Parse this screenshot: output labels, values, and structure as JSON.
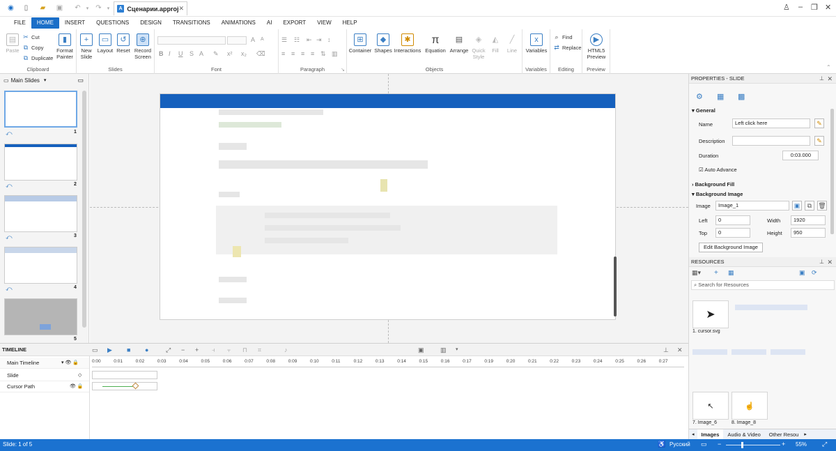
{
  "window": {
    "doc_title": "Сценарии.approj"
  },
  "menu": {
    "items": [
      "FILE",
      "HOME",
      "INSERT",
      "QUESTIONS",
      "DESIGN",
      "TRANSITIONS",
      "ANIMATIONS",
      "AI",
      "EXPORT",
      "VIEW",
      "HELP"
    ],
    "active": "HOME"
  },
  "ribbon": {
    "clipboard": {
      "label": "Clipboard",
      "paste": "Paste",
      "cut": "Cut",
      "copy": "Copy",
      "duplicate": "Duplicate",
      "format_painter": "Format Painter"
    },
    "slides": {
      "label": "Slides",
      "new_slide": "New Slide",
      "layout": "Layout",
      "reset": "Reset",
      "record_screen": "Record Screen"
    },
    "font": {
      "label": "Font"
    },
    "paragraph": {
      "label": "Paragraph"
    },
    "objects": {
      "label": "Objects",
      "container": "Container",
      "shapes": "Shapes",
      "interactions": "Interactions",
      "equation": "Equation",
      "arrange": "Arrange",
      "quick_style": "Quick Style",
      "fill": "Fill",
      "line": "Line"
    },
    "variables": {
      "label": "Variables",
      "button": "Variables"
    },
    "editing": {
      "label": "Editing",
      "find": "Find",
      "replace": "Replace"
    },
    "preview": {
      "label": "Preview",
      "button": "HTML5 Preview"
    }
  },
  "slides_panel": {
    "header": "Main Slides",
    "numbers": [
      "1",
      "2",
      "3",
      "4",
      "5"
    ]
  },
  "properties": {
    "title": "PROPERTIES - SLIDE",
    "general": "General",
    "name_label": "Name",
    "name_value": "Left click here",
    "description_label": "Description",
    "description_value": "",
    "duration_label": "Duration",
    "duration_value": "0:03.000",
    "auto_advance": "Auto Advance",
    "background_fill": "Background Fill",
    "background_image": "Background Image",
    "image_label": "Image",
    "image_value": "Image_1",
    "left_label": "Left",
    "left_value": "0",
    "width_label": "Width",
    "width_value": "1920",
    "top_label": "Top",
    "top_value": "0",
    "height_label": "Height",
    "height_value": "950",
    "edit_bg_button": "Edit Background Image"
  },
  "resources": {
    "title": "RESOURCES",
    "search_placeholder": "Search for Resources",
    "items": [
      "1. cursor.svg",
      "7. Image_6",
      "8. Image_8"
    ],
    "tabs": [
      "Images",
      "Audio & Video",
      "Other Resou"
    ]
  },
  "timeline": {
    "title": "TIMELINE",
    "rows": [
      "Main Timeline",
      "Slide",
      "Cursor Path"
    ],
    "ticks": [
      "0:00",
      "0:01",
      "0:02",
      "0:03",
      "0:04",
      "0:05",
      "0:06",
      "0:07",
      "0:08",
      "0:09",
      "0:10",
      "0:11",
      "0:12",
      "0:13",
      "0:14",
      "0:15",
      "0:16",
      "0:17",
      "0:19",
      "0:20",
      "0:21",
      "0:22",
      "0:23",
      "0:24",
      "0:25",
      "0:26",
      "0:27"
    ]
  },
  "status": {
    "slide": "Slide: 1 of 5",
    "language": "Русский",
    "zoom": "55%"
  },
  "colors": {
    "accent": "#1b6fc8",
    "slide_header": "#1560bd",
    "status": "#1b72d0"
  }
}
